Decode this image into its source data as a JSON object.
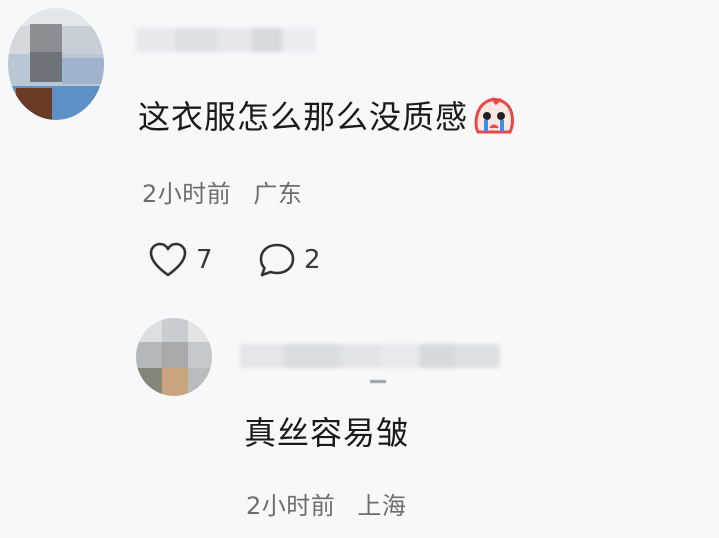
{
  "comment": {
    "text": "这衣服怎么那么没质感",
    "emoji": "crying-face-emoji",
    "time": "2小时前",
    "location": "广东",
    "likes": "7",
    "replies": "2"
  },
  "reply": {
    "text": "真丝容易皱",
    "time": "2小时前",
    "location": "上海"
  },
  "colors": {
    "background": "#f7f8fa",
    "text": "#1a1a1a",
    "meta": "#6d6d6d",
    "emoji_red": "#e8484a"
  }
}
